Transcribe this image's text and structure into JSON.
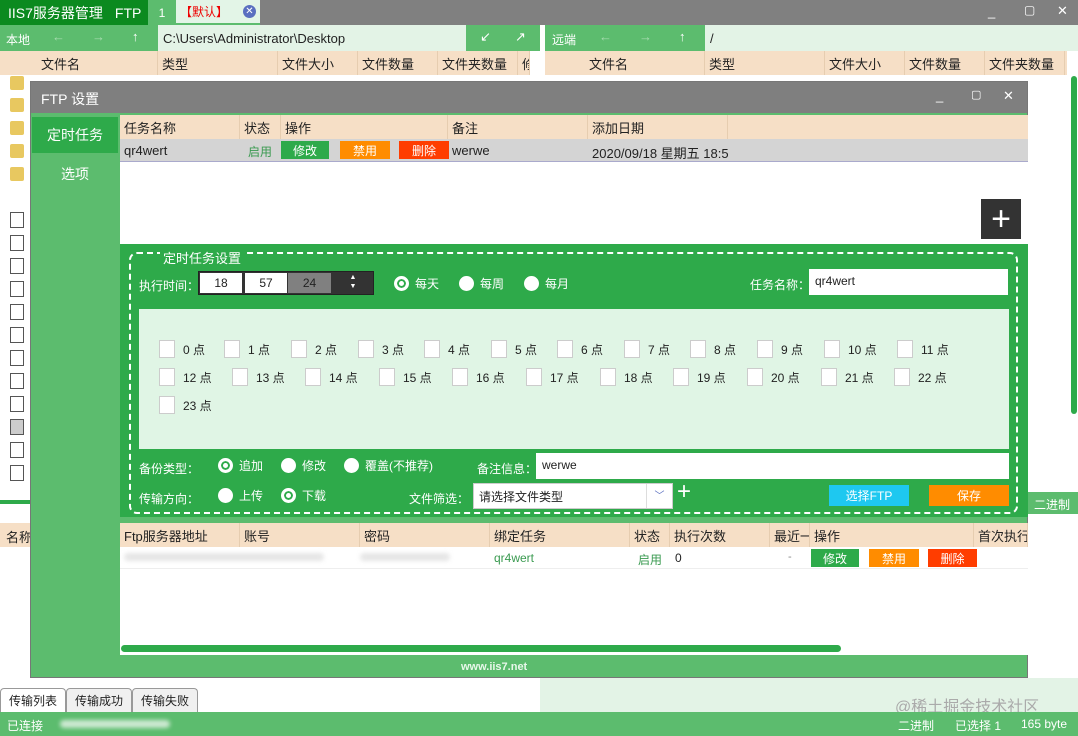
{
  "app": {
    "title": "IIS7服务器管理",
    "section": "FTP",
    "tab_index": "1",
    "tab_name": "【默认】"
  },
  "local": {
    "label": "本地",
    "path": "C:\\Users\\Administrator\\Desktop",
    "columns": [
      "文件名",
      "类型",
      "文件大小",
      "文件数量",
      "文件夹数量",
      "修"
    ]
  },
  "remote": {
    "label": "远端",
    "path": "/",
    "columns": [
      "文件名",
      "类型",
      "文件大小",
      "文件数量",
      "文件夹数量"
    ],
    "binary": "二进制"
  },
  "left_lower": {
    "name_col": "名称"
  },
  "dialog": {
    "title": "FTP 设置",
    "sidebar": [
      "定时任务",
      "选项"
    ],
    "task_table": {
      "columns": [
        "任务名称",
        "状态",
        "操作",
        "备注",
        "添加日期"
      ],
      "rows": [
        {
          "name": "qr4wert",
          "status": "启用",
          "edit": "修改",
          "disable": "禁用",
          "delete": "删除",
          "note": "werwe",
          "date": "2020/09/18 星期五 18:5"
        }
      ]
    },
    "settings": {
      "legend": "定时任务设置",
      "exec_time_label": "执行时间：",
      "hour": "18",
      "minute": "57",
      "second": "24",
      "freq": [
        "每天",
        "每周",
        "每月"
      ],
      "freq_selected": 0,
      "task_name_label": "任务名称：",
      "task_name": "qr4wert",
      "hours": [
        "0 点",
        "1 点",
        "2 点",
        "3 点",
        "4 点",
        "5 点",
        "6 点",
        "7 点",
        "8 点",
        "9 点",
        "10 点",
        "11 点",
        "12 点",
        "13 点",
        "14 点",
        "15 点",
        "16 点",
        "17 点",
        "18 点",
        "19 点",
        "20 点",
        "21 点",
        "22 点",
        "23 点"
      ],
      "backup_label": "备份类型：",
      "backup": [
        "追加",
        "修改",
        "覆盖(不推荐)"
      ],
      "backup_selected": 0,
      "note_label": "备注信息：",
      "note": "werwe",
      "direction_label": "传输方向：",
      "direction": [
        "上传",
        "下载"
      ],
      "direction_selected": 1,
      "filter_label": "文件筛选：",
      "filter_placeholder": "请选择文件类型",
      "select_ftp": "选择FTP",
      "save": "保存"
    },
    "ftp_table": {
      "columns": [
        "Ftp服务器地址",
        "账号",
        "密码",
        "绑定任务",
        "状态",
        "执行次数",
        "最近一",
        "操作",
        "首次执行"
      ],
      "rows": [
        {
          "task": "qr4wert",
          "status": "启用",
          "count": "0",
          "recent": "-",
          "edit": "修改",
          "disable": "禁用",
          "delete": "删除"
        }
      ]
    },
    "footer": "www.iis7.net"
  },
  "bottom_tabs": [
    "传输列表",
    "传输成功",
    "传输失败"
  ],
  "status": {
    "connected": "已连接",
    "mode": "二进制",
    "selected": "已选择 1",
    "size": "165 byte"
  },
  "watermark": "@稀土掘金技术社区"
}
